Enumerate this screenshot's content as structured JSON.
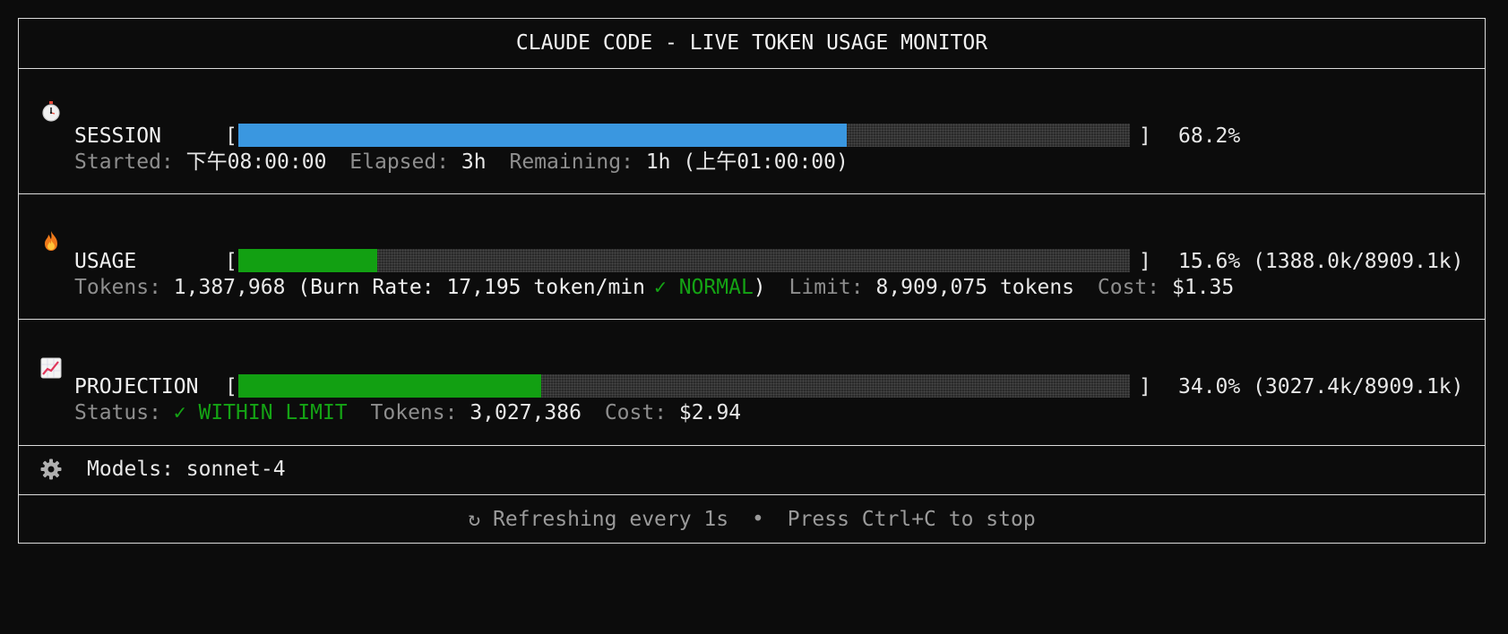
{
  "title": "CLAUDE CODE - LIVE TOKEN USAGE MONITOR",
  "session": {
    "icon": "stopwatch-icon",
    "label": "SESSION",
    "progress_percent": 68.2,
    "percent_text": "68.2%",
    "bar_color": "#3a97e0",
    "started_label": "Started:",
    "started_value": "下午08:00:00",
    "elapsed_label": "Elapsed:",
    "elapsed_value": "3h",
    "remaining_label": "Remaining:",
    "remaining_value": "1h (上午01:00:00)"
  },
  "usage": {
    "icon": "fire-icon",
    "label": "USAGE",
    "progress_percent": 15.6,
    "percent_text": "15.6% (1388.0k/8909.1k)",
    "bar_color": "#12a012",
    "tokens_label": "Tokens:",
    "tokens_value": "1,387,968",
    "burn_prefix": "(Burn Rate: 17,195 token/min",
    "burn_status": "✓ NORMAL",
    "burn_suffix": ")",
    "limit_label": "Limit:",
    "limit_value": "8,909,075 tokens",
    "cost_label": "Cost:",
    "cost_value": "$1.35"
  },
  "projection": {
    "icon": "chart-increasing-icon",
    "label": "PROJECTION",
    "progress_percent": 34.0,
    "percent_text": "34.0% (3027.4k/8909.1k)",
    "bar_color": "#12a012",
    "status_label": "Status:",
    "status_value": "✓ WITHIN LIMIT",
    "tokens_label": "Tokens:",
    "tokens_value": "3,027,386",
    "cost_label": "Cost:",
    "cost_value": "$2.94"
  },
  "models": {
    "icon": "gear-icon",
    "text": "Models: sonnet-4"
  },
  "footer": {
    "icon": "refresh-icon",
    "refresh_glyph": "↻",
    "refresh_text": "Refreshing every 1s",
    "separator": "•",
    "stop_text": "Press Ctrl+C to stop"
  },
  "colors": {
    "background": "#0c0c0c",
    "border": "#dcdcdc",
    "session_bar": "#3a97e0",
    "usage_bar": "#12a012",
    "ok_text": "#14a314",
    "dim_text": "#8e8e8e"
  }
}
